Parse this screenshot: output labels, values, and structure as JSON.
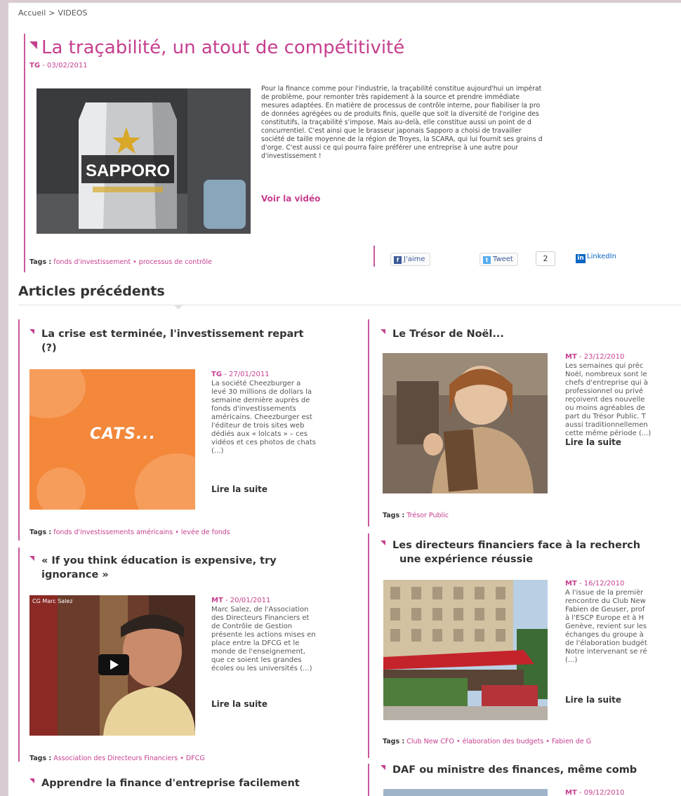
{
  "breadcrumb": {
    "home": "Accueil",
    "separator": ">",
    "current": "VIDEOS"
  },
  "main": {
    "title": "La traçabilité, un atout de compétitivité",
    "author": "TG",
    "date": "03/02/2011",
    "text_lines": [
      "Pour la finance comme pour l'industrie, la traçabilité constitue aujourd'hui un impérat",
      "de problème, pour remonter très rapidement à la source et prendre immédiate",
      "mesures adaptées. En matière de processus de contrôle interne, pour fiabiliser la pro",
      "de données agrégées ou de produits finis, quelle que soit la diversité de l'origine des",
      "constitutifs, la traçabilité s'impose. Mais au-delà, elle constitue aussi un point de d",
      "concurrentiel. C'est ainsi que le brasseur japonais Sapporo a choisi de travailler",
      "société de taille moyenne de la région de Troyes, la SCARA, qui lui fournit ses grains d",
      "d'orge. C'est aussi ce qui pourra faire préférer une entreprise à une autre pour",
      "d'investissement !"
    ],
    "video_link": "Voir la vidéo",
    "image_text": "SAPPORO",
    "tags_label": "Tags :",
    "tags": [
      "fonds d'investissement",
      "processus de contrôle"
    ],
    "tag_separator": "•",
    "social": {
      "like": "J'aime",
      "tweet": "Tweet",
      "tweet_count": "2",
      "linkedin": "LinkedIn"
    }
  },
  "previous": {
    "heading": "Articles précédents",
    "lire_label": "Lire la suite",
    "tags_label": "Tags :",
    "left": [
      {
        "title_lines": [
          "La crise est terminée, l'investissement repart",
          "(?)"
        ],
        "author": "TG",
        "date": "27/01/2011",
        "body_lines": [
          "La société Cheezburger a",
          "levé 30 millions de dollars la",
          "semaine dernière auprès de",
          "fonds d'investissements",
          "américains. Cheezburger est",
          "l'éditeur de trois sites web",
          "dédiés aux « lolcats » – ces",
          "vidéos et ces photos de chats",
          "(...)"
        ],
        "image_text": "CATS...",
        "tags": [
          "fonds d'investissements américains",
          "levée de fonds"
        ]
      },
      {
        "title_lines": [
          "« If you think éducation is expensive, try",
          "ignorance »"
        ],
        "author": "MT",
        "date": "20/01/2011",
        "body_lines": [
          "Marc Salez, de l'Association",
          "des Directeurs Financiers et",
          "de Contrôle de Gestion",
          "présente les actions mises en",
          "place entre la DFCG et le",
          "monde de l'enseignement,",
          "que ce soient les grandes",
          "écoles ou les universités (...)"
        ],
        "image_text": "CG Marc Salez",
        "tags": [
          "Association des Directeurs Financiers",
          "DFCG"
        ]
      },
      {
        "title_lines": [
          "Apprendre la finance d'entreprise facilement"
        ]
      }
    ],
    "right": [
      {
        "title_lines": [
          "Le Trésor de Noël..."
        ],
        "author": "MT",
        "date": "23/12/2010",
        "body_lines": [
          "Les semaines qui préc",
          "Noël, nombreux sont le",
          "chefs d'entreprise qui à",
          "professionnel ou privé",
          "reçoivent des nouvelle",
          "ou moins agréables de",
          "part du Trésor Public. T",
          "aussi traditionnellemen",
          "cette même période (...)"
        ],
        "tags": [
          "Trésor Public"
        ]
      },
      {
        "title_lines": [
          "Les directeurs financiers face à la recherch",
          "une expérience réussie"
        ],
        "author": "MT",
        "date": "16/12/2010",
        "body_lines": [
          "A l'issue de la premièr",
          "rencontre du Club New",
          "Fabien de Geuser, prof",
          "à l'ESCP Europe et à H",
          "Genève, revient sur les",
          "échanges du groupe à",
          "de l'élaboration budgét",
          "Notre intervenant se ré",
          "(...)"
        ],
        "tags": [
          "Club New CFO",
          "élaboration des budgets",
          "Fabien de G"
        ]
      },
      {
        "title_lines": [
          "DAF ou ministre des finances, même comb"
        ],
        "author": "MT",
        "date": "09/12/2010"
      }
    ]
  }
}
